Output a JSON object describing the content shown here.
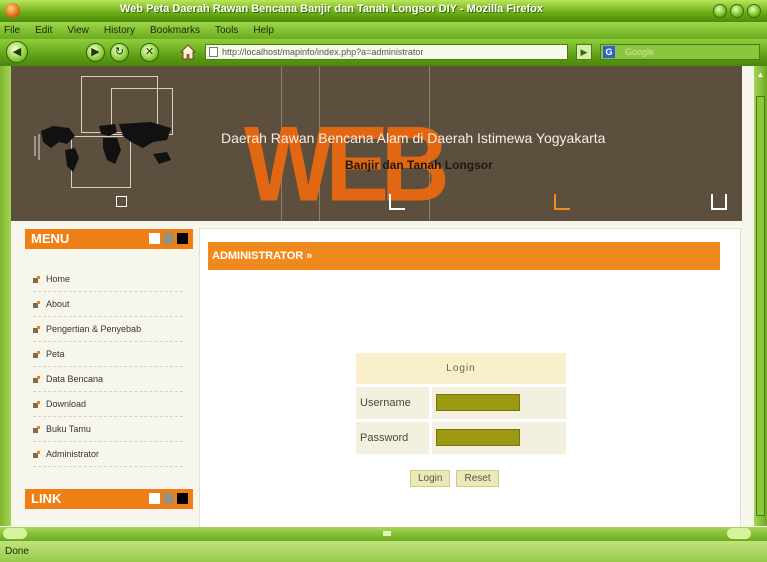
{
  "window": {
    "title": "Web Peta Daerah Rawan Bencana Banjir dan Tanah Longsor DIY - Mozilla Firefox"
  },
  "menubar": {
    "items": [
      "File",
      "Edit",
      "View",
      "History",
      "Bookmarks",
      "Tools",
      "Help"
    ]
  },
  "navbar": {
    "url": "http://localhost/mapinfo/index.php?a=administrator",
    "search_placeholder": "Google"
  },
  "header": {
    "logo_text": "WEB",
    "title": "Daerah Rawan Bencana Alam di Daerah Istimewa Yogyakarta",
    "subtitle": "Banjir dan Tanah Longsor"
  },
  "sidebar": {
    "menu_title": "MENU",
    "items": [
      "Home",
      "About",
      "Pengertian & Penyebab",
      "Peta",
      "Data Bencana",
      "Download",
      "Buku Tamu",
      "Administrator"
    ],
    "link_title": "LINK",
    "square_colors": [
      "#ffffff",
      "#9a8f78",
      "#000000"
    ]
  },
  "content": {
    "section_title": "ADMINISTRATOR »",
    "login": {
      "title": "Login",
      "username_label": "Username",
      "password_label": "Password",
      "username_value": "",
      "password_value": "",
      "login_button": "Login",
      "reset_button": "Reset"
    }
  },
  "statusbar": {
    "text": "Done"
  },
  "colors": {
    "accent": "#ee7f17",
    "header_bg": "#5c4f3e",
    "field_bg": "#9b9a12",
    "chrome_green": "#6aaa14"
  }
}
